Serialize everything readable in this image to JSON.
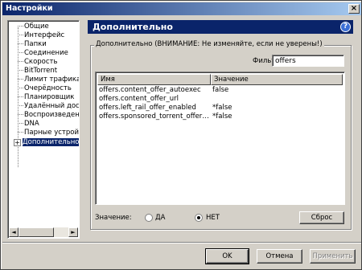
{
  "window": {
    "title": "Настройки",
    "close_symbol": "×"
  },
  "tree": {
    "items": [
      {
        "label": "Общие"
      },
      {
        "label": "Интерфейс"
      },
      {
        "label": "Папки"
      },
      {
        "label": "Соединение"
      },
      {
        "label": "Скорость"
      },
      {
        "label": "BitTorrent"
      },
      {
        "label": "Лимит трафика"
      },
      {
        "label": "Очерёдность"
      },
      {
        "label": "Планировщик"
      },
      {
        "label": "Удалённый доступ"
      },
      {
        "label": "Воспроизведение"
      },
      {
        "label": "DNA"
      },
      {
        "label": "Парные устройства"
      },
      {
        "label": "Дополнительно"
      }
    ],
    "expander_symbol": "+",
    "scroll_left": "◄",
    "scroll_right": "►"
  },
  "header": {
    "title": "Дополнительно",
    "help_symbol": "?"
  },
  "group": {
    "legend": "Дополнительно (ВНИМАНИЕ: Не изменяйте, если не уверены!)"
  },
  "filter": {
    "label": "Фильтр",
    "value": "offers"
  },
  "table": {
    "columns": [
      "Имя",
      "Значение"
    ],
    "rows": [
      {
        "name": "offers.content_offer_autoexec",
        "value": "false"
      },
      {
        "name": "offers.content_offer_url",
        "value": ""
      },
      {
        "name": "offers.left_rail_offer_enabled",
        "value": "*false"
      },
      {
        "name": "offers.sponsored_torrent_offer_enabled",
        "value": "*false"
      }
    ]
  },
  "value_control": {
    "label": "Значение:",
    "options": [
      {
        "label": "ДА",
        "checked": false
      },
      {
        "label": "НЕТ",
        "checked": true
      }
    ],
    "reset_label": "Сброс"
  },
  "footer": {
    "ok_label": "OK",
    "cancel_label": "Отмена",
    "apply_label": "Применить"
  },
  "colors": {
    "title_bar": "#0a246a",
    "selection": "#0a246a",
    "face": "#d4d0c8"
  }
}
